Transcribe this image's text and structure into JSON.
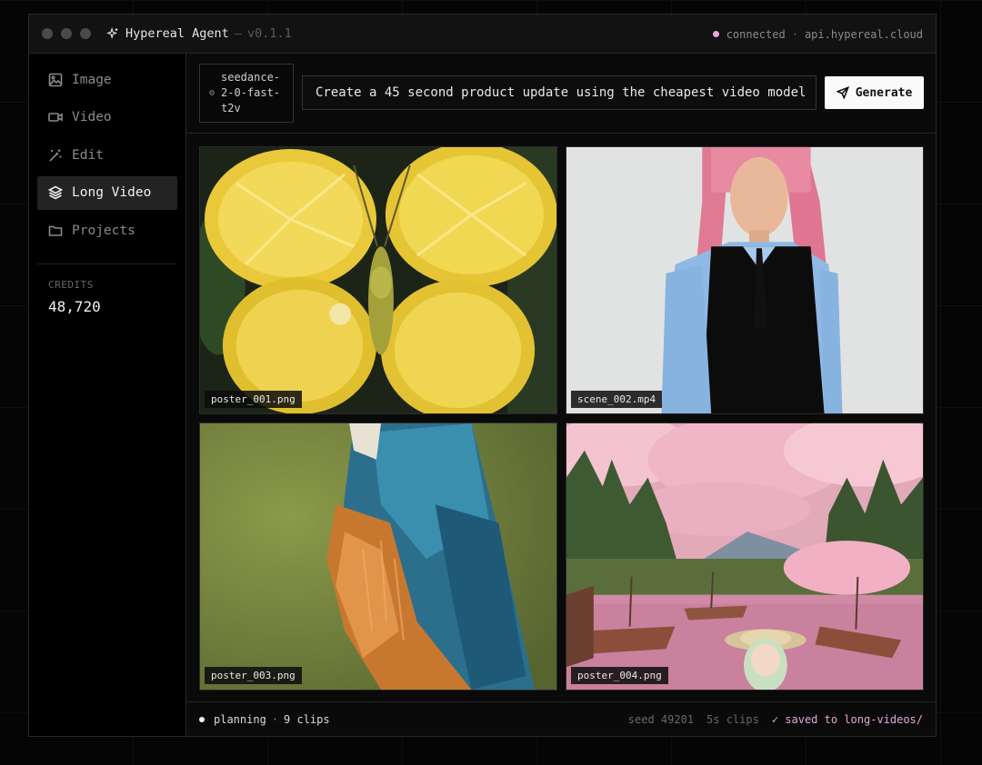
{
  "titlebar": {
    "app_name": "Hypereal Agent",
    "separator": "—",
    "version": "v0.1.1",
    "status": "connected",
    "status_sep": "·",
    "endpoint": "api.hypereal.cloud",
    "status_color": "#e8a8d8"
  },
  "sidebar": {
    "items": [
      {
        "label": "Image",
        "icon": "image-icon"
      },
      {
        "label": "Video",
        "icon": "video-icon"
      },
      {
        "label": "Edit",
        "icon": "magic-wand-icon"
      },
      {
        "label": "Long Video",
        "icon": "layers-icon",
        "active": true
      },
      {
        "label": "Projects",
        "icon": "folder-icon"
      }
    ],
    "credits_label": "CREDITS",
    "credits_value": "48,720"
  },
  "toolbar": {
    "model_line1": "seedance-",
    "model_line2": "2-0-fast-",
    "model_line3": "t2v",
    "model_icon": "chip-icon",
    "prompt_value": "Create a 45 second product update using the cheapest video model",
    "generate_label": "Generate"
  },
  "gallery": {
    "tiles": [
      {
        "filename": "poster_001.png",
        "subject": "lemon-butterfly"
      },
      {
        "filename": "scene_002.mp4",
        "subject": "pink-hair-woman"
      },
      {
        "filename": "poster_003.png",
        "subject": "kingfisher"
      },
      {
        "filename": "poster_004.png",
        "subject": "pink-anime-lake"
      }
    ]
  },
  "statusbar": {
    "state": "planning",
    "sep": "·",
    "clips": "9 clips",
    "seed": "seed 49201",
    "clip_len": "5s clips",
    "saved": "✓ saved to long-videos/",
    "saved_color": "#e4a9d6"
  }
}
